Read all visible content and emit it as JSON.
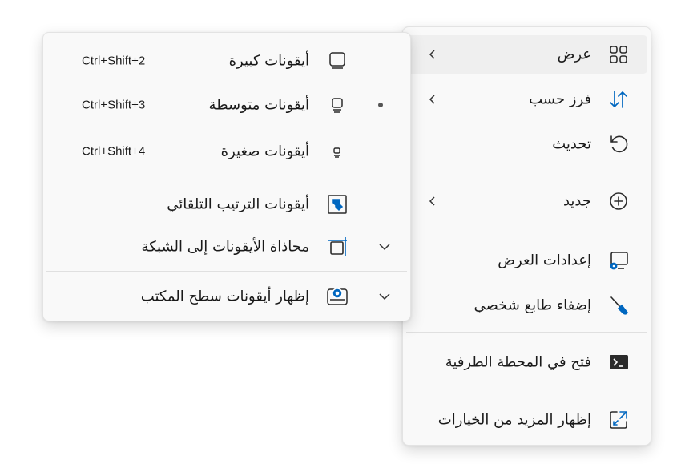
{
  "main_menu": {
    "items": [
      {
        "label": "عرض",
        "icon": "grid-icon",
        "submenu": true
      },
      {
        "label": "فرز حسب",
        "icon": "sort-arrows-icon",
        "submenu": true
      },
      {
        "label": "تحديث",
        "icon": "refresh-icon"
      },
      {
        "label": "جديد",
        "icon": "add-circle-icon",
        "submenu": true
      },
      {
        "label": "إعدادات العرض",
        "icon": "display-settings-icon"
      },
      {
        "label": "إضفاء طابع شخصي",
        "icon": "paintbrush-icon"
      },
      {
        "label": "فتح في المحطة الطرفية",
        "icon": "terminal-icon"
      },
      {
        "label": "إظهار المزيد من الخيارات",
        "icon": "expand-icon"
      }
    ]
  },
  "view_submenu": {
    "items": [
      {
        "label": "أيقونات كبيرة",
        "shortcut": "Ctrl+Shift+2",
        "icon": "large-icons-icon"
      },
      {
        "label": "أيقونات متوسطة",
        "shortcut": "Ctrl+Shift+3",
        "icon": "medium-icons-icon",
        "selected": true
      },
      {
        "label": "أيقونات صغيرة",
        "shortcut": "Ctrl+Shift+4",
        "icon": "small-icons-icon"
      },
      {
        "label": "أيقونات الترتيب التلقائي",
        "icon": "auto-arrange-icon"
      },
      {
        "label": "محاذاة الأيقونات إلى الشبكة",
        "icon": "align-grid-icon",
        "checked": true
      },
      {
        "label": "إظهار أيقونات سطح المكتب",
        "icon": "show-desktop-icons-icon",
        "checked": true
      }
    ]
  },
  "colors": {
    "accent": "#0067c0",
    "text": "#1a1a1a",
    "menu_bg": "#f9f9f9",
    "hover_bg": "#efefef"
  }
}
